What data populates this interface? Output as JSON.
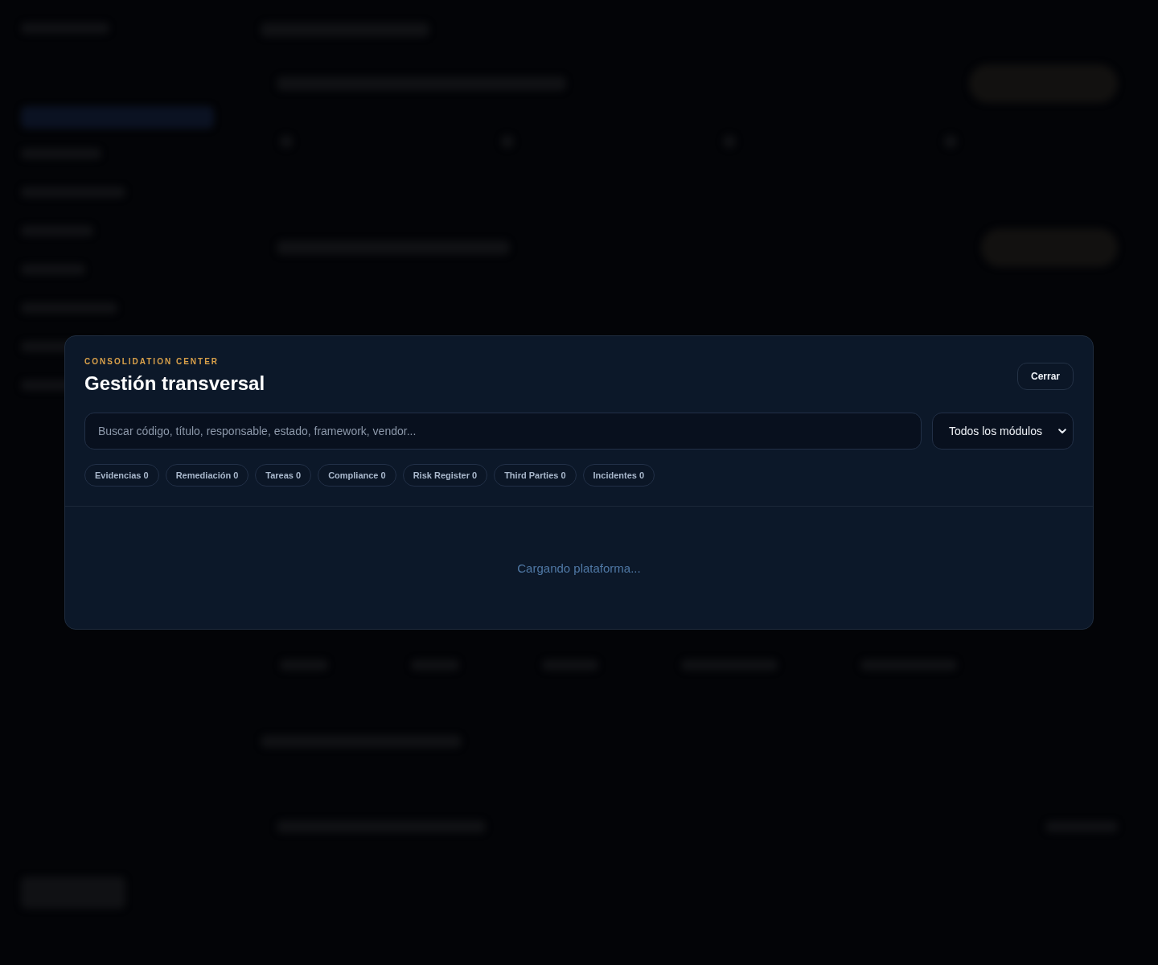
{
  "modal": {
    "eyebrow": "CONSOLIDATION CENTER",
    "title": "Gestión transversal",
    "close_button": "Cerrar",
    "search": {
      "placeholder": "Buscar código, título, responsable, estado, framework, vendor..."
    },
    "module_select": {
      "value": "Todos los módulos"
    },
    "chips": [
      {
        "label": "Evidencias 0"
      },
      {
        "label": "Remediación 0"
      },
      {
        "label": "Tareas 0"
      },
      {
        "label": "Compliance 0"
      },
      {
        "label": "Risk Register 0"
      },
      {
        "label": "Third Parties 0"
      },
      {
        "label": "Incidentes 0"
      }
    ],
    "body": {
      "status": "Cargando plataforma..."
    }
  }
}
